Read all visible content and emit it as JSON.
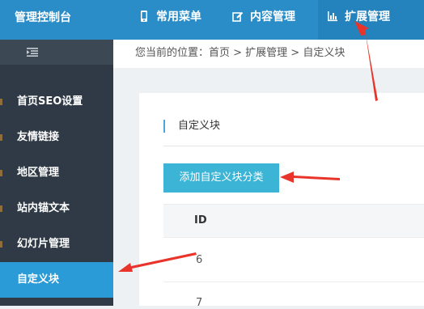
{
  "header": {
    "brand": "管理控制台",
    "nav": [
      {
        "label": "常用菜单",
        "icon": "phone-icon"
      },
      {
        "label": "内容管理",
        "icon": "edit-icon"
      },
      {
        "label": "扩展管理",
        "icon": "bar-chart-icon",
        "active": true
      }
    ],
    "bg_color": "#2a8dc8"
  },
  "sidebar": {
    "collapse_icon": "collapse-menu-icon",
    "items": [
      {
        "label": "首页SEO设置"
      },
      {
        "label": "友情链接"
      },
      {
        "label": "地区管理"
      },
      {
        "label": "站内锚文本"
      },
      {
        "label": "幻灯片管理"
      },
      {
        "label": "自定义块",
        "active": true
      }
    ],
    "bg_color": "#2f3a46",
    "active_color": "#2a9bd6"
  },
  "breadcrumb": {
    "text": "您当前的位置：首页 > 扩展管理 > 自定义块"
  },
  "main": {
    "section_title": "自定义块",
    "add_button_label": "添加自定义块分类",
    "table": {
      "headers": [
        "ID"
      ],
      "rows": [
        {
          "id": "6"
        },
        {
          "id": "7"
        }
      ]
    }
  },
  "annotations": {
    "arrow_color": "#e8342a"
  }
}
